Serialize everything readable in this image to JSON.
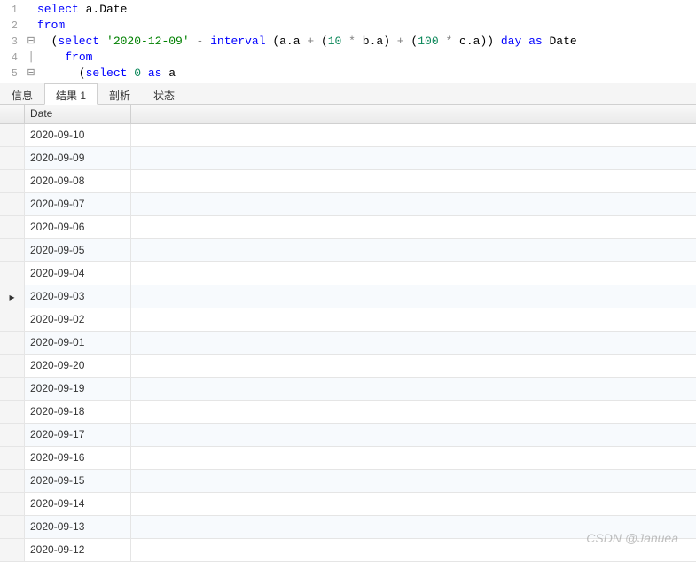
{
  "editor": {
    "lines": [
      {
        "num": "1",
        "fold": "",
        "tokens": [
          {
            "cls": "kw",
            "t": "select"
          },
          {
            "cls": "",
            "t": " a.Date"
          }
        ]
      },
      {
        "num": "2",
        "fold": "",
        "tokens": [
          {
            "cls": "kw",
            "t": "from"
          }
        ]
      },
      {
        "num": "3",
        "fold": "⊟",
        "tokens": [
          {
            "cls": "",
            "t": "  ("
          },
          {
            "cls": "kw",
            "t": "select"
          },
          {
            "cls": "",
            "t": " "
          },
          {
            "cls": "str",
            "t": "'2020-12-09'"
          },
          {
            "cls": "",
            "t": " "
          },
          {
            "cls": "op",
            "t": "-"
          },
          {
            "cls": "",
            "t": " "
          },
          {
            "cls": "kw",
            "t": "interval"
          },
          {
            "cls": "",
            "t": " (a.a "
          },
          {
            "cls": "op",
            "t": "+"
          },
          {
            "cls": "",
            "t": " ("
          },
          {
            "cls": "num",
            "t": "10"
          },
          {
            "cls": "",
            "t": " "
          },
          {
            "cls": "op",
            "t": "*"
          },
          {
            "cls": "",
            "t": " b.a) "
          },
          {
            "cls": "op",
            "t": "+"
          },
          {
            "cls": "",
            "t": " ("
          },
          {
            "cls": "num",
            "t": "100"
          },
          {
            "cls": "",
            "t": " "
          },
          {
            "cls": "op",
            "t": "*"
          },
          {
            "cls": "",
            "t": " c.a)) "
          },
          {
            "cls": "kw",
            "t": "day"
          },
          {
            "cls": "",
            "t": " "
          },
          {
            "cls": "kw",
            "t": "as"
          },
          {
            "cls": "",
            "t": " Date"
          }
        ]
      },
      {
        "num": "4",
        "fold": "│",
        "tokens": [
          {
            "cls": "",
            "t": "    "
          },
          {
            "cls": "kw",
            "t": "from"
          }
        ]
      },
      {
        "num": "5",
        "fold": "⊟",
        "tokens": [
          {
            "cls": "",
            "t": "      ("
          },
          {
            "cls": "kw",
            "t": "select"
          },
          {
            "cls": "",
            "t": " "
          },
          {
            "cls": "num",
            "t": "0"
          },
          {
            "cls": "",
            "t": " "
          },
          {
            "cls": "kw",
            "t": "as"
          },
          {
            "cls": "",
            "t": " a"
          }
        ]
      }
    ]
  },
  "tabs": {
    "items": [
      {
        "label": "信息",
        "active": false
      },
      {
        "label": "结果 1",
        "active": true
      },
      {
        "label": "剖析",
        "active": false
      },
      {
        "label": "状态",
        "active": false
      }
    ]
  },
  "results": {
    "column_header": "Date",
    "active_row_index": 7,
    "rows": [
      "2020-09-10",
      "2020-09-09",
      "2020-09-08",
      "2020-09-07",
      "2020-09-06",
      "2020-09-05",
      "2020-09-04",
      "2020-09-03",
      "2020-09-02",
      "2020-09-01",
      "2020-09-20",
      "2020-09-19",
      "2020-09-18",
      "2020-09-17",
      "2020-09-16",
      "2020-09-15",
      "2020-09-14",
      "2020-09-13",
      "2020-09-12"
    ]
  },
  "watermark": "CSDN @Januea"
}
